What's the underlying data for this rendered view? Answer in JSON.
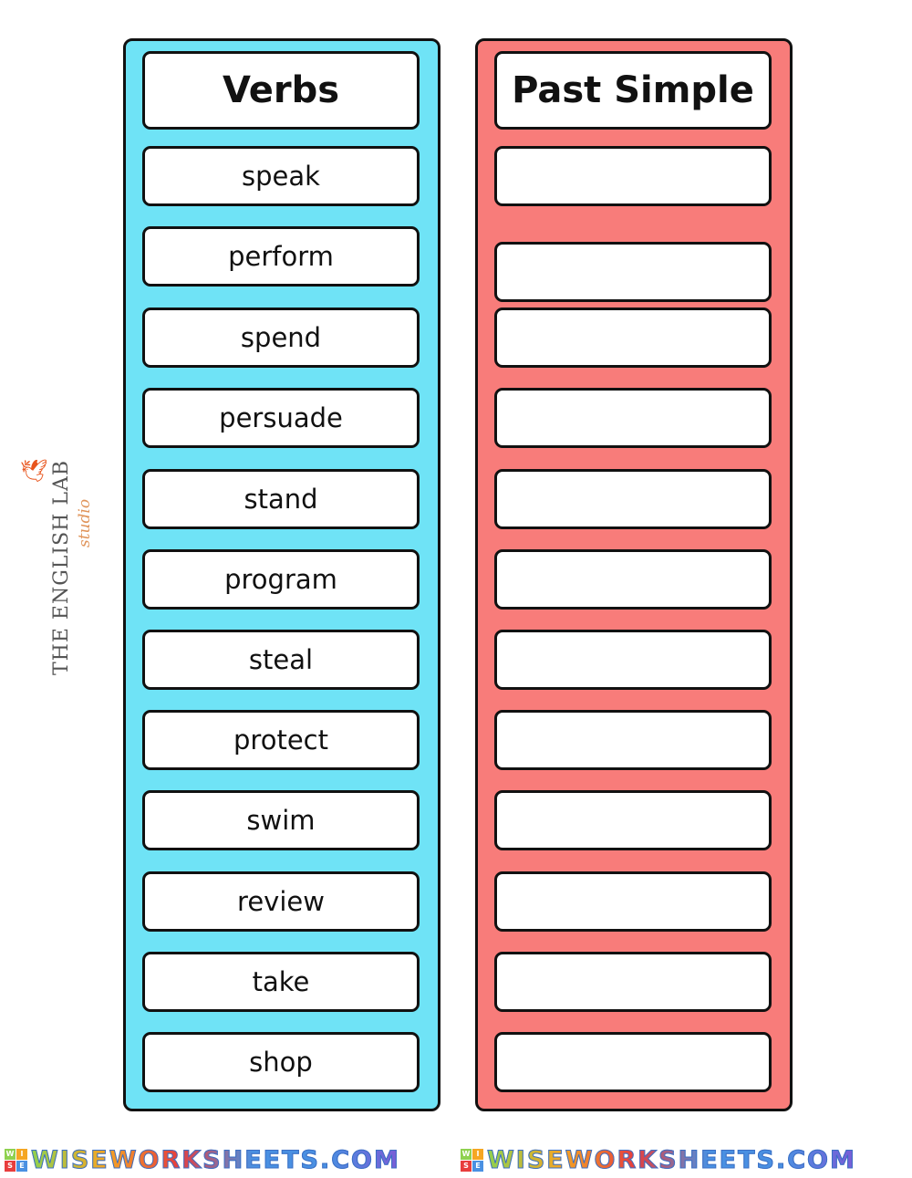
{
  "left_column": {
    "header": "Verbs",
    "items": [
      "speak",
      "perform",
      "spend",
      "persuade",
      "stand",
      "program",
      "steal",
      "protect",
      "swim",
      "review",
      "take",
      "shop"
    ]
  },
  "right_column": {
    "header": "Past Simple",
    "answers": [
      "",
      "",
      "",
      "",
      "",
      "",
      "",
      "",
      "",
      "",
      "",
      ""
    ]
  },
  "logo": {
    "title": "THE ENGLISH LAB",
    "subtitle": "studio"
  },
  "footer": {
    "text": "WISEWORKSHEETS.COM",
    "badge": [
      "W",
      "I",
      "S",
      "E"
    ]
  },
  "colors": {
    "verbs_panel": "#6fe3f6",
    "past_panel": "#f87c7a"
  }
}
